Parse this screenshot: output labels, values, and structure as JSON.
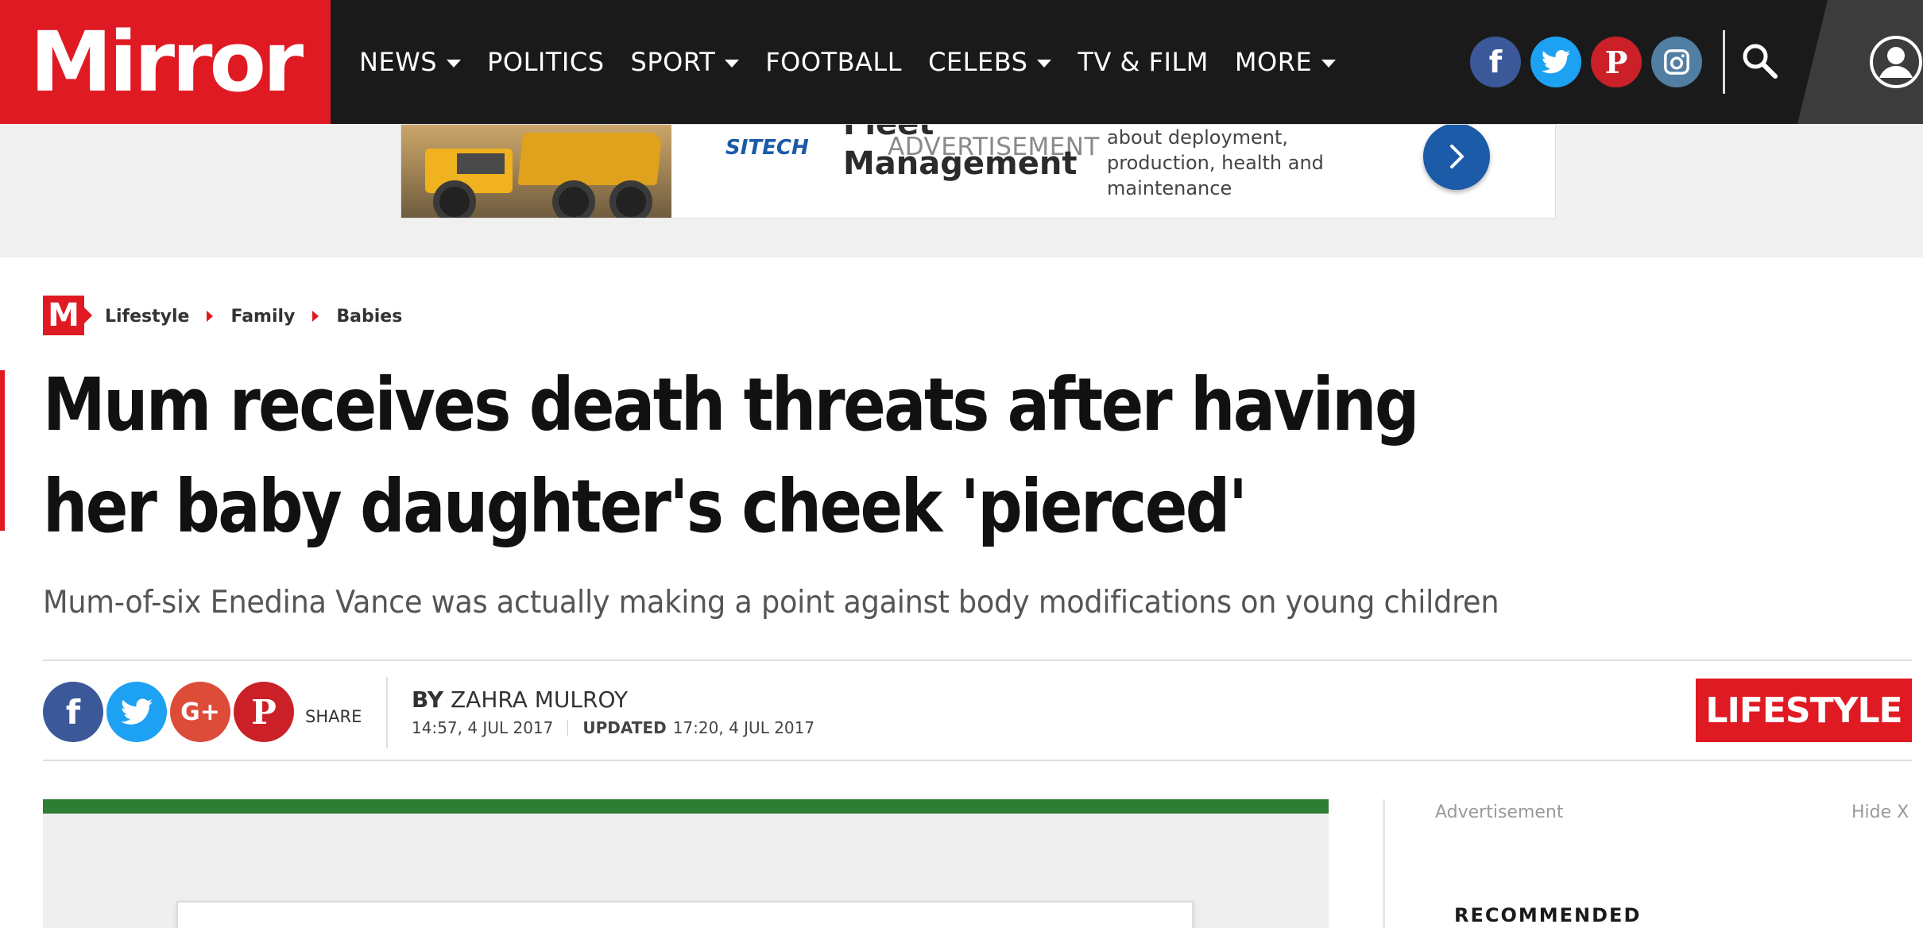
{
  "brand": {
    "logo_text": "Mirror"
  },
  "nav": {
    "items": [
      {
        "label": "NEWS",
        "has_dropdown": true
      },
      {
        "label": "POLITICS",
        "has_dropdown": false
      },
      {
        "label": "SPORT",
        "has_dropdown": true
      },
      {
        "label": "FOOTBALL",
        "has_dropdown": false
      },
      {
        "label": "CELEBS",
        "has_dropdown": true
      },
      {
        "label": "TV & FILM",
        "has_dropdown": false
      },
      {
        "label": "MORE",
        "has_dropdown": true
      }
    ],
    "social": [
      {
        "name": "facebook-icon",
        "glyph": "f",
        "color": "#3b5998"
      },
      {
        "name": "twitter-icon",
        "glyph": "t",
        "color": "#1da1f2"
      },
      {
        "name": "pinterest-icon",
        "glyph": "P",
        "color": "#cb2027"
      },
      {
        "name": "instagram-icon",
        "glyph": "◎",
        "color": "#517fa4"
      }
    ]
  },
  "advert": {
    "label": "ADVERTISEMENT",
    "brand": "SITECH",
    "headline_line1": "Fleet",
    "headline_line2": "Management",
    "text": "about deployment, production, health and maintenance"
  },
  "breadcrumb": {
    "logo": "M",
    "items": [
      "Lifestyle",
      "Family",
      "Babies"
    ]
  },
  "article": {
    "headline": "Mum receives death threats after having her baby daughter's cheek 'pierced'",
    "standfirst": "Mum-of-six Enedina Vance was actually making a point against body modifications on young children",
    "byline_prefix": "BY",
    "author": "ZAHRA MULROY",
    "published": "14:57, 4 JUL 2017",
    "updated_label": "UPDATED",
    "updated": "17:20, 4 JUL 2017",
    "section": "LIFESTYLE"
  },
  "share": {
    "label": "SHARE",
    "buttons": [
      {
        "name": "share-facebook-icon",
        "glyph": "f",
        "color": "#3b5998"
      },
      {
        "name": "share-twitter-icon",
        "glyph": "t",
        "color": "#1da1f2"
      },
      {
        "name": "share-googleplus-icon",
        "glyph": "G+",
        "color": "#dd4b39"
      },
      {
        "name": "share-pinterest-icon",
        "glyph": "P",
        "color": "#cb2027"
      }
    ]
  },
  "sidebar": {
    "ad_caption": "Advertisement",
    "hide_label": "Hide X",
    "recommended": "RECOMMENDED"
  },
  "colors": {
    "brand_red": "#e01a22",
    "header_bg": "#1a1a1a",
    "accent_green": "#2e7d32"
  }
}
